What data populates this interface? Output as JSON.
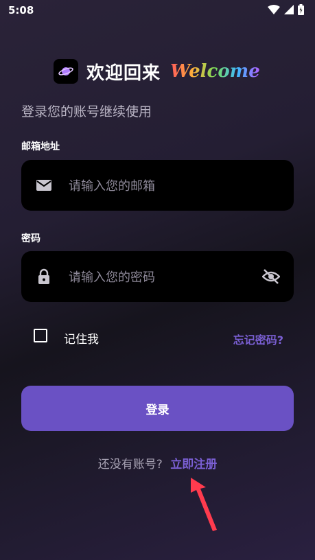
{
  "status": {
    "time": "5:08"
  },
  "header": {
    "title": "欢迎回来",
    "welcome": "Welcome"
  },
  "subtitle": "登录您的账号继续使用",
  "email": {
    "label": "邮箱地址",
    "placeholder": "请输入您的邮箱"
  },
  "password": {
    "label": "密码",
    "placeholder": "请输入您的密码"
  },
  "remember": {
    "label": "记住我",
    "checked": false
  },
  "forgot": "忘记密码?",
  "login": "登录",
  "register": {
    "question": "还没有账号?",
    "link": "立即注册"
  },
  "colors": {
    "accent": "#6a51c4",
    "link": "#7a5fd3",
    "field_bg": "#000000",
    "annotation_arrow": "#ff3b4e"
  }
}
